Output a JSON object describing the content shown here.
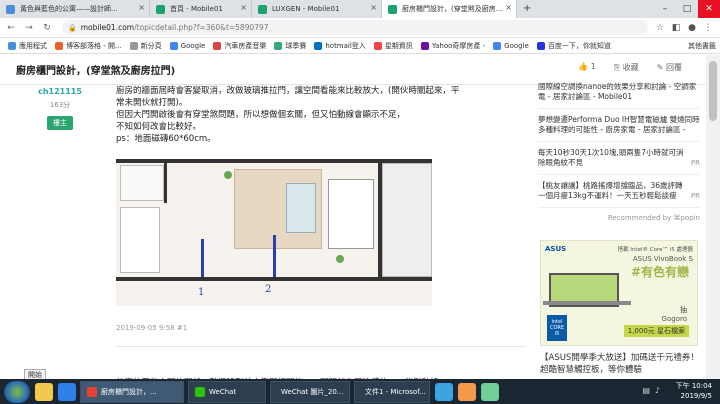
{
  "tabs": [
    {
      "label": "黃色與藍色的公寓——設計師..."
    },
    {
      "label": "首頁 - Mobile01"
    },
    {
      "label": "LUXGEN - Mobile01"
    },
    {
      "label": "廚房櫃門設計，(穿堂煞及廚房..."
    }
  ],
  "address": {
    "host": "mobile01.com",
    "path": "/topicdetail.php?f=360&t=5890797"
  },
  "bookmarks": [
    "應用程式",
    "博客部落格 - 開...",
    "新分頁",
    "Google",
    "汽車房產音樂",
    "球季賽",
    "hotmail登入",
    "星期資訊",
    "Yahoo奇摩房產 -",
    "Google",
    "百度一下，你就知道"
  ],
  "bookmarks_right": "其他書籤",
  "header": {
    "title": "廚房櫃門設計，(穿堂煞及廚房拉門)",
    "count": "1",
    "collect": "收藏",
    "reply": "回覆"
  },
  "user": {
    "name": "ch121115",
    "posts": "163分",
    "badge": "樓主"
  },
  "post": {
    "lines": [
      "廚房的牆面屆時會客變取消，改做玻璃推拉門，讓空間看能來比較放大，(開伙時關起來，平",
      "常未開伙就打開)。",
      "但因大門開啟後會有穿堂煞問題，所以想做個玄關，但又怕動線會顯示不足，",
      "不知如何改會比較好。",
      "ps：地面磁磚60*60cm。"
    ],
    "marker1": "1",
    "marker2": "2",
    "time": "2019-09-05 9:58 #1"
  },
  "next_post_text": "依真的要做玄關的門縫，鞋櫃移到前方靠門打開後，一開門就有壓迫感的...一些引動線",
  "sidebar": [
    {
      "text": "國際線空調換nanoe的效果分享和討論 - 空調家電 - 居家討論區 - Mobile01",
      "pr": ""
    },
    {
      "text": "夢想變遷Performa Duo IH智慧電磁爐 雙燒同時多種料理的可能性 - 廚房家電 - 居家討論區 -",
      "pr": ""
    },
    {
      "text": "每天10秒30天1次10塊,頭兩隻7小時就可消除眼角紋不見",
      "pr": "PR"
    },
    {
      "text": "【桃友讓讓】桃路搖爆增擋臨品，36歲評轉一個月瘦13kg不運料！一天五秒輕鬆談瘦",
      "pr": "PR"
    }
  ],
  "recommended": "Recommended by ⌘popin",
  "ad": {
    "brand": "ASUS",
    "intel_tag": "搭載 Intel® Core™ i5 處理器",
    "model": "ASUS VivoBook S",
    "slogan": "#有色有戀",
    "gogoro1": "抽",
    "gogoro2": "Gogoro",
    "gogoro3": "1,000元 星石檔案",
    "intel": "intel CORE i5"
  },
  "ad_caption": "【ASUS開學季大放送】加碼送千元禮券！超酷智慧觸控板，等你體驗",
  "status_popup": "開始",
  "taskbar": {
    "apps": [
      "廚房櫃門設計，...",
      "WeChat",
      "WeChat 圖片_20...",
      "文件1 - Microsof..."
    ],
    "time": "下午 10:04",
    "date": "2019/9/5"
  }
}
